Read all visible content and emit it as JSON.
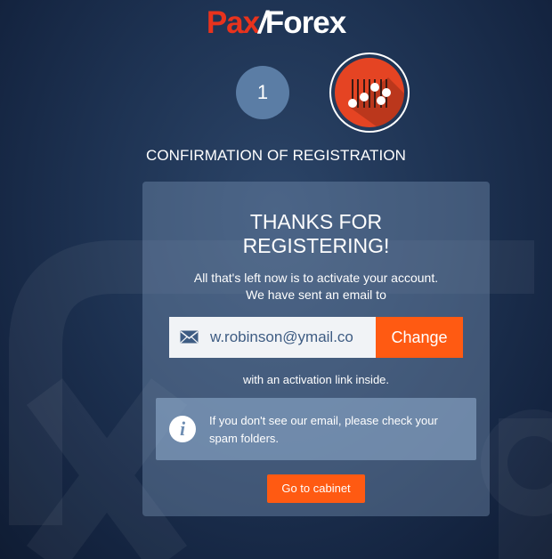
{
  "brand": {
    "part1": "Pax",
    "separator": "/",
    "part2": "Forex"
  },
  "steps": {
    "step1_number": "1",
    "step2_icon": "sliders-icon"
  },
  "page_heading": "CONFIRMATION OF REGISTRATION",
  "card": {
    "title_line1": "THANKS FOR",
    "title_line2": "REGISTERING!",
    "text_line1": "All that's left now is to activate your account.",
    "text_line2": "We have sent an email to",
    "email_value": "w.robinson@ymail.co",
    "change_label": "Change",
    "activation_text": "with an activation link inside.",
    "notice_text": "If you don't see our email, please check your spam folders.",
    "info_icon_glyph": "i",
    "cabinet_label": "Go to cabinet"
  },
  "colors": {
    "accent_orange": "#ff5a12",
    "brand_red": "#e8331d",
    "step1_blue": "#5b7da5",
    "step2_red": "#e54423",
    "email_text": "#3e5c83"
  }
}
